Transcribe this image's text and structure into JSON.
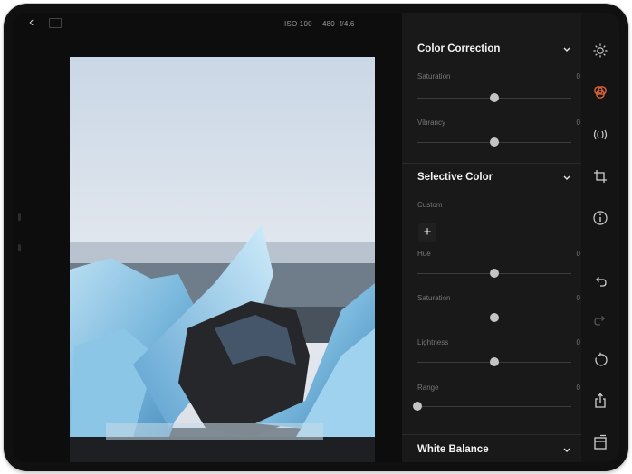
{
  "topbar": {
    "iso": "ISO 100",
    "exposure": "480",
    "aperture": "f/4.6"
  },
  "panel": {
    "color_correction": {
      "title": "Color Correction",
      "rows": [
        {
          "label": "Saturation",
          "value": "0",
          "level": 0.5
        },
        {
          "label": "Vibrancy",
          "value": "0",
          "level": 0.5
        }
      ]
    },
    "selective_color": {
      "title": "Selective Color",
      "custom_label": "Custom",
      "add_label": "+",
      "rows": [
        {
          "label": "Hue",
          "value": "0",
          "level": 0.5
        },
        {
          "label": "Saturation",
          "value": "0",
          "level": 0.5
        },
        {
          "label": "Lightness",
          "value": "0",
          "level": 0.5
        },
        {
          "label": "Range",
          "value": "0",
          "level": 0.0
        }
      ]
    },
    "white_balance": {
      "title": "White Balance"
    }
  },
  "rail": {
    "icons": [
      "light-icon",
      "color-icon",
      "effects-icon",
      "crop-icon",
      "info-icon",
      "undo-icon",
      "redo-icon",
      "revert-icon",
      "share-icon",
      "compare-icon"
    ]
  },
  "colors": {
    "accent": "#e0623a",
    "panel_bg": "#191919",
    "rail_bg": "#141414"
  }
}
